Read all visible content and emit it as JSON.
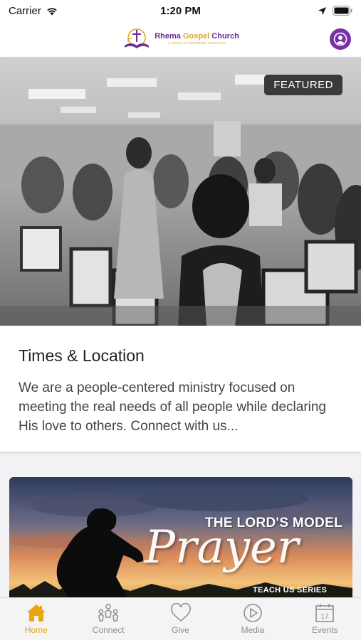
{
  "status_bar": {
    "carrier": "Carrier",
    "time": "1:20 PM"
  },
  "header": {
    "logo_name_part1": "Rhema ",
    "logo_name_part2": "Gospel",
    "logo_name_part3": " Church",
    "logo_tagline": "A PEOPLE-CENTERED MINISTRY"
  },
  "featured": {
    "badge": "FEATURED",
    "title": "Times & Location",
    "description": "We are a people-centered ministry focused on meeting the real needs of all people while declaring His love to others. Connect with us..."
  },
  "prayer_card": {
    "title": "THE LORD'S MODEL",
    "script": "Prayer",
    "series": "TEACH US SERIES"
  },
  "tabs": [
    {
      "label": "Home",
      "icon": "home-icon",
      "active": true
    },
    {
      "label": "Connect",
      "icon": "people-icon",
      "active": false
    },
    {
      "label": "Give",
      "icon": "heart-icon",
      "active": false
    },
    {
      "label": "Media",
      "icon": "play-icon",
      "active": false
    },
    {
      "label": "Events",
      "icon": "calendar-icon",
      "active": false
    }
  ],
  "colors": {
    "accent": "#e8a80c",
    "brand_purple": "#7b2fa6",
    "tab_inactive": "#8e8e8e"
  }
}
